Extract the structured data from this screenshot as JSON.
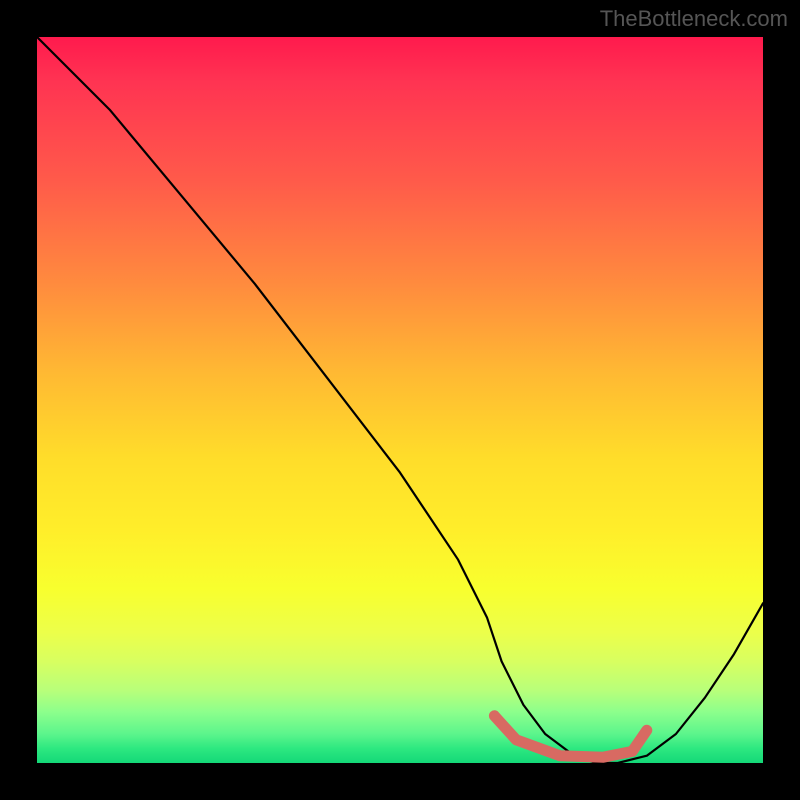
{
  "attribution": "TheBottleneck.com",
  "chart_data": {
    "type": "line",
    "title": "",
    "xlabel": "",
    "ylabel": "",
    "xlim": [
      0,
      100
    ],
    "ylim": [
      0,
      100
    ],
    "grid": false,
    "legend": false,
    "series": [
      {
        "name": "bottleneck-curve",
        "color": "#000000",
        "x": [
          0,
          4,
          10,
          20,
          30,
          40,
          50,
          58,
          62,
          64,
          67,
          70,
          74,
          77,
          80,
          84,
          88,
          92,
          96,
          100
        ],
        "values": [
          100,
          96,
          90,
          78,
          66,
          53,
          40,
          28,
          20,
          14,
          8,
          4,
          1,
          0,
          0,
          1,
          4,
          9,
          15,
          22
        ]
      }
    ],
    "annotations": [
      {
        "name": "optimal-range-highlight",
        "type": "segment",
        "color": "#d86a62",
        "x": [
          63,
          66,
          72,
          78,
          82,
          84
        ],
        "values": [
          6.5,
          3.2,
          1.0,
          0.8,
          1.6,
          4.5
        ]
      }
    ],
    "background_gradient": {
      "type": "vertical",
      "stops": [
        {
          "pos": 0.0,
          "color": "#ff1a4d"
        },
        {
          "pos": 0.2,
          "color": "#ff5b4a"
        },
        {
          "pos": 0.46,
          "color": "#ffb833"
        },
        {
          "pos": 0.68,
          "color": "#ffee2a"
        },
        {
          "pos": 0.86,
          "color": "#d8ff60"
        },
        {
          "pos": 1.0,
          "color": "#14d878"
        }
      ]
    }
  }
}
